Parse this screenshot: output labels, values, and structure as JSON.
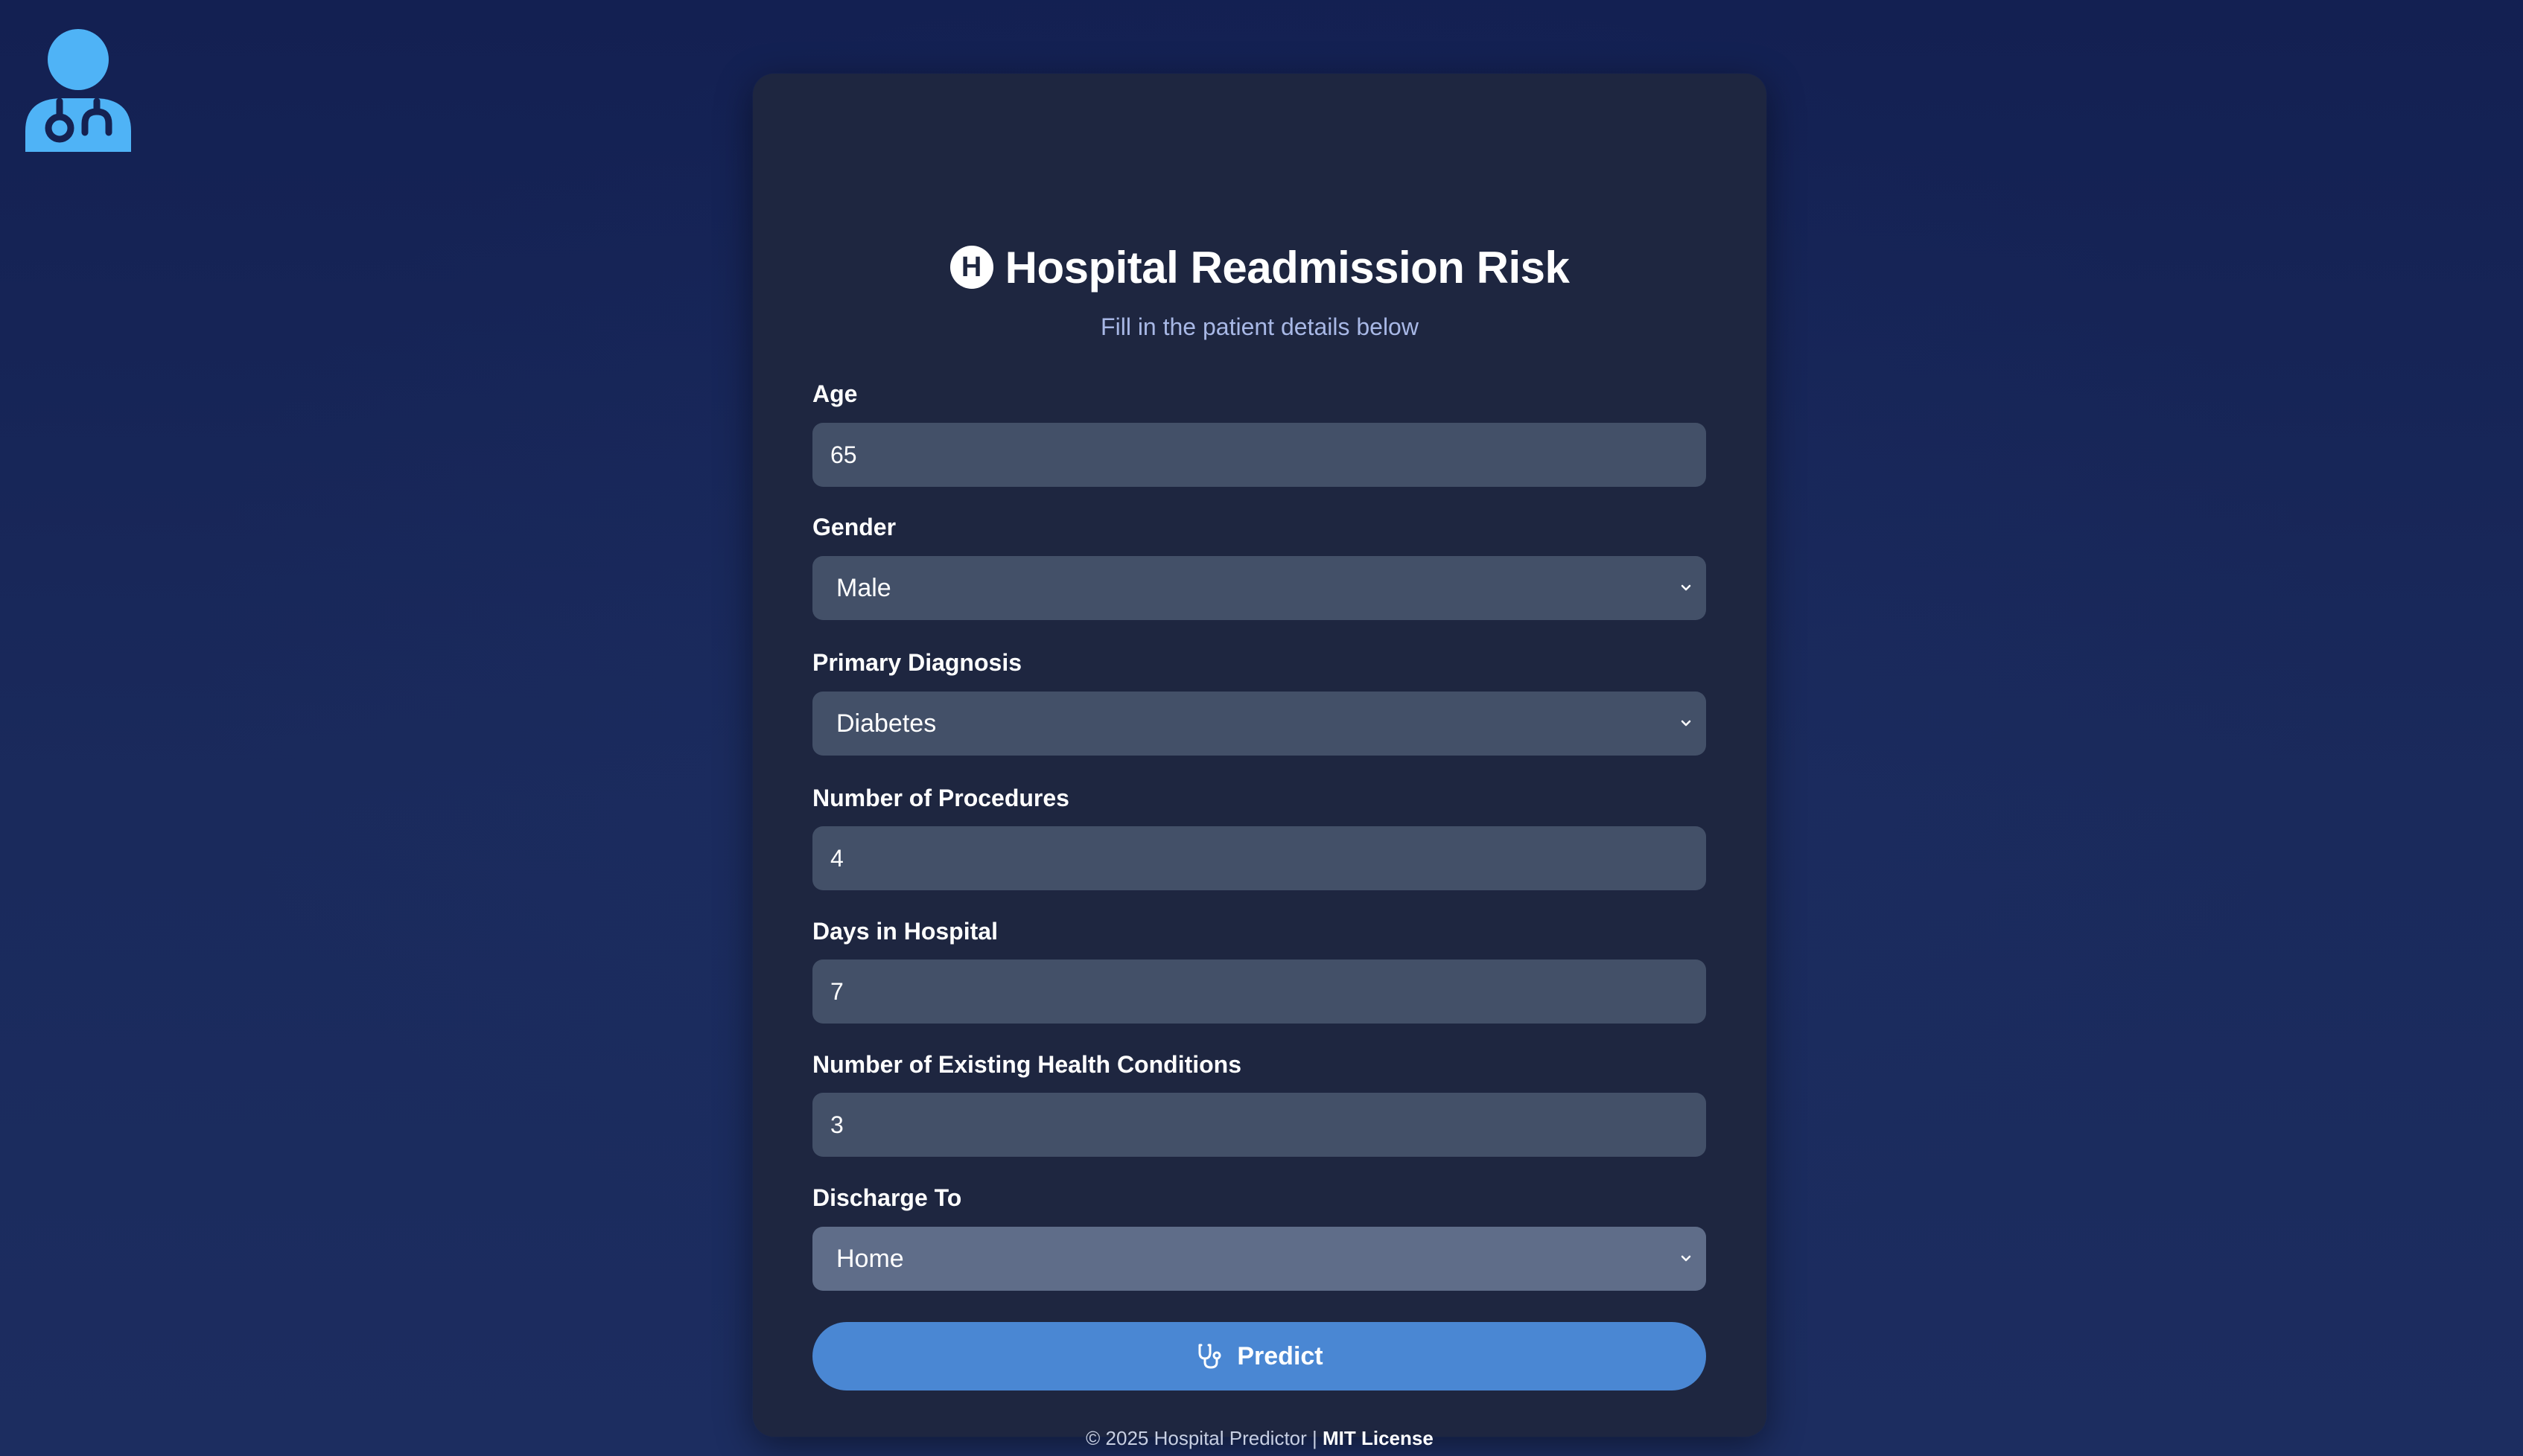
{
  "header": {
    "title": "Hospital Readmission Risk",
    "title_icon_letter": "H",
    "subtitle": "Fill in the patient details below"
  },
  "form": {
    "age": {
      "label": "Age",
      "value": "65"
    },
    "gender": {
      "label": "Gender",
      "value": "Male"
    },
    "diagnosis": {
      "label": "Primary Diagnosis",
      "value": "Diabetes"
    },
    "procedures": {
      "label": "Number of Procedures",
      "value": "4"
    },
    "days": {
      "label": "Days in Hospital",
      "value": "7"
    },
    "conditions": {
      "label": "Number of Existing Health Conditions",
      "value": "3"
    },
    "discharge": {
      "label": "Discharge To",
      "value": "Home"
    }
  },
  "predict_button": {
    "label": "Predict",
    "icon": "stethoscope-icon"
  },
  "footer": {
    "text": "© 2025 Hospital Predictor | ",
    "link": "MIT License"
  },
  "logo": {
    "icon": "doctor-avatar-icon"
  },
  "colors": {
    "background": "#152151",
    "card": "#1e2640",
    "input": "#435068",
    "input_active": "#5f6d89",
    "accent": "#4a87d3",
    "logo": "#4fb3f6",
    "subtitle": "#a8b8e6"
  }
}
